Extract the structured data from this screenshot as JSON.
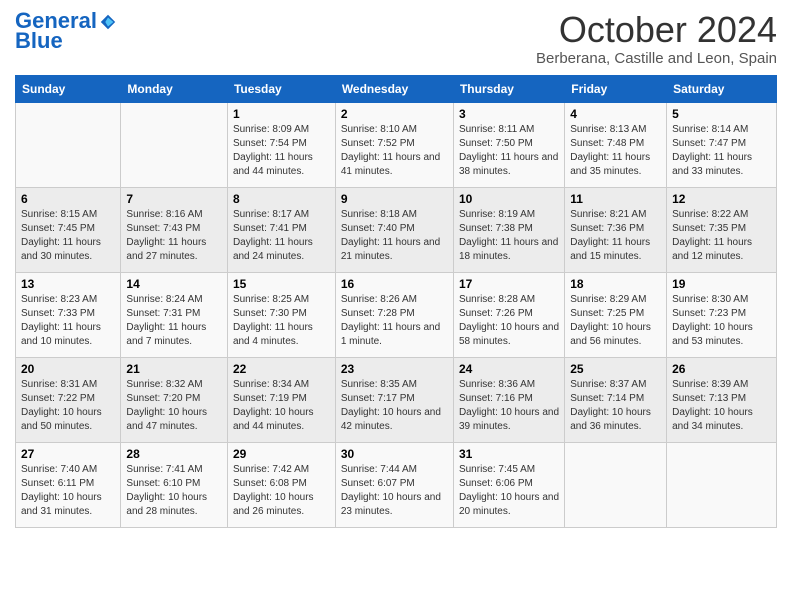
{
  "header": {
    "logo_line1": "General",
    "logo_line2": "Blue",
    "title": "October 2024",
    "subtitle": "Berberana, Castille and Leon, Spain"
  },
  "days_of_week": [
    "Sunday",
    "Monday",
    "Tuesday",
    "Wednesday",
    "Thursday",
    "Friday",
    "Saturday"
  ],
  "weeks": [
    [
      {
        "day": "",
        "info": ""
      },
      {
        "day": "",
        "info": ""
      },
      {
        "day": "1",
        "info": "Sunrise: 8:09 AM\nSunset: 7:54 PM\nDaylight: 11 hours and 44 minutes."
      },
      {
        "day": "2",
        "info": "Sunrise: 8:10 AM\nSunset: 7:52 PM\nDaylight: 11 hours and 41 minutes."
      },
      {
        "day": "3",
        "info": "Sunrise: 8:11 AM\nSunset: 7:50 PM\nDaylight: 11 hours and 38 minutes."
      },
      {
        "day": "4",
        "info": "Sunrise: 8:13 AM\nSunset: 7:48 PM\nDaylight: 11 hours and 35 minutes."
      },
      {
        "day": "5",
        "info": "Sunrise: 8:14 AM\nSunset: 7:47 PM\nDaylight: 11 hours and 33 minutes."
      }
    ],
    [
      {
        "day": "6",
        "info": "Sunrise: 8:15 AM\nSunset: 7:45 PM\nDaylight: 11 hours and 30 minutes."
      },
      {
        "day": "7",
        "info": "Sunrise: 8:16 AM\nSunset: 7:43 PM\nDaylight: 11 hours and 27 minutes."
      },
      {
        "day": "8",
        "info": "Sunrise: 8:17 AM\nSunset: 7:41 PM\nDaylight: 11 hours and 24 minutes."
      },
      {
        "day": "9",
        "info": "Sunrise: 8:18 AM\nSunset: 7:40 PM\nDaylight: 11 hours and 21 minutes."
      },
      {
        "day": "10",
        "info": "Sunrise: 8:19 AM\nSunset: 7:38 PM\nDaylight: 11 hours and 18 minutes."
      },
      {
        "day": "11",
        "info": "Sunrise: 8:21 AM\nSunset: 7:36 PM\nDaylight: 11 hours and 15 minutes."
      },
      {
        "day": "12",
        "info": "Sunrise: 8:22 AM\nSunset: 7:35 PM\nDaylight: 11 hours and 12 minutes."
      }
    ],
    [
      {
        "day": "13",
        "info": "Sunrise: 8:23 AM\nSunset: 7:33 PM\nDaylight: 11 hours and 10 minutes."
      },
      {
        "day": "14",
        "info": "Sunrise: 8:24 AM\nSunset: 7:31 PM\nDaylight: 11 hours and 7 minutes."
      },
      {
        "day": "15",
        "info": "Sunrise: 8:25 AM\nSunset: 7:30 PM\nDaylight: 11 hours and 4 minutes."
      },
      {
        "day": "16",
        "info": "Sunrise: 8:26 AM\nSunset: 7:28 PM\nDaylight: 11 hours and 1 minute."
      },
      {
        "day": "17",
        "info": "Sunrise: 8:28 AM\nSunset: 7:26 PM\nDaylight: 10 hours and 58 minutes."
      },
      {
        "day": "18",
        "info": "Sunrise: 8:29 AM\nSunset: 7:25 PM\nDaylight: 10 hours and 56 minutes."
      },
      {
        "day": "19",
        "info": "Sunrise: 8:30 AM\nSunset: 7:23 PM\nDaylight: 10 hours and 53 minutes."
      }
    ],
    [
      {
        "day": "20",
        "info": "Sunrise: 8:31 AM\nSunset: 7:22 PM\nDaylight: 10 hours and 50 minutes."
      },
      {
        "day": "21",
        "info": "Sunrise: 8:32 AM\nSunset: 7:20 PM\nDaylight: 10 hours and 47 minutes."
      },
      {
        "day": "22",
        "info": "Sunrise: 8:34 AM\nSunset: 7:19 PM\nDaylight: 10 hours and 44 minutes."
      },
      {
        "day": "23",
        "info": "Sunrise: 8:35 AM\nSunset: 7:17 PM\nDaylight: 10 hours and 42 minutes."
      },
      {
        "day": "24",
        "info": "Sunrise: 8:36 AM\nSunset: 7:16 PM\nDaylight: 10 hours and 39 minutes."
      },
      {
        "day": "25",
        "info": "Sunrise: 8:37 AM\nSunset: 7:14 PM\nDaylight: 10 hours and 36 minutes."
      },
      {
        "day": "26",
        "info": "Sunrise: 8:39 AM\nSunset: 7:13 PM\nDaylight: 10 hours and 34 minutes."
      }
    ],
    [
      {
        "day": "27",
        "info": "Sunrise: 7:40 AM\nSunset: 6:11 PM\nDaylight: 10 hours and 31 minutes."
      },
      {
        "day": "28",
        "info": "Sunrise: 7:41 AM\nSunset: 6:10 PM\nDaylight: 10 hours and 28 minutes."
      },
      {
        "day": "29",
        "info": "Sunrise: 7:42 AM\nSunset: 6:08 PM\nDaylight: 10 hours and 26 minutes."
      },
      {
        "day": "30",
        "info": "Sunrise: 7:44 AM\nSunset: 6:07 PM\nDaylight: 10 hours and 23 minutes."
      },
      {
        "day": "31",
        "info": "Sunrise: 7:45 AM\nSunset: 6:06 PM\nDaylight: 10 hours and 20 minutes."
      },
      {
        "day": "",
        "info": ""
      },
      {
        "day": "",
        "info": ""
      }
    ]
  ]
}
